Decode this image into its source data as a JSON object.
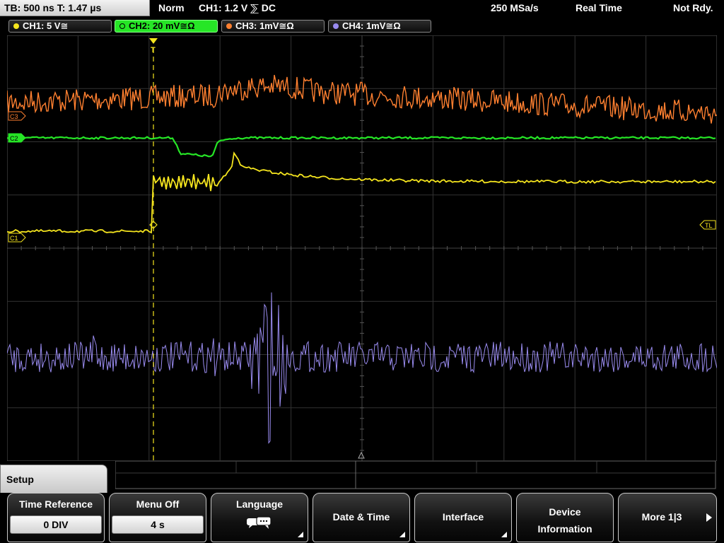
{
  "header": {
    "timebase": "TB: 500 ns   T: 1.47 µs",
    "mode": "Norm",
    "trigger": "CH1: 1.2 V ⅀ DC",
    "sample_rate": "250 MSa/s",
    "acq_mode": "Real Time",
    "status": "Not Rdy."
  },
  "channels": [
    {
      "label": "CH1: 5 V≅",
      "color": "#f5e51e"
    },
    {
      "label": "CH2: 20 mV≅Ω",
      "color": "#26e626"
    },
    {
      "label": "CH3: 1mV≅Ω",
      "color": "#ff8030"
    },
    {
      "label": "CH4: 1mV≅Ω",
      "color": "#9a8cf0"
    }
  ],
  "markers": {
    "c1": "C1",
    "c2": "C2",
    "c3": "C3",
    "trigger_level": "TL",
    "trigger_pos": "T"
  },
  "menu": {
    "title": "Setup",
    "time_reference": {
      "label": "Time Reference",
      "value": "0 DIV"
    },
    "menu_off": {
      "label": "Menu Off",
      "value": "4 s"
    },
    "language": {
      "label": "Language"
    },
    "date_time": {
      "label": "Date & Time"
    },
    "interface": {
      "label": "Interface"
    },
    "device_info": {
      "line1": "Device",
      "line2": "Information"
    },
    "more": {
      "label": "More 1|3"
    }
  },
  "colors": {
    "ch1": "#f5e51e",
    "ch2": "#26e626",
    "ch3": "#ff8030",
    "ch4": "#9a8cf0",
    "grid": "#3a3a3a"
  }
}
